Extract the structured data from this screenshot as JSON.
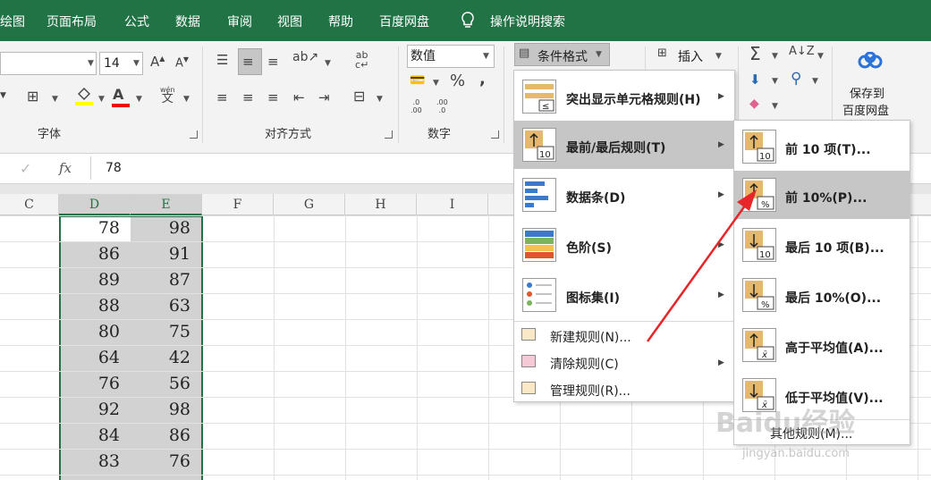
{
  "menubar": {
    "items": [
      "绘图",
      "页面布局",
      "公式",
      "数据",
      "审阅",
      "视图",
      "帮助",
      "百度网盘",
      "操作说明搜索"
    ]
  },
  "ribbon": {
    "font_size": "14",
    "font_group_label": "字体",
    "align_group_label": "对齐方式",
    "number_format": "数值",
    "number_group_label": "数字",
    "percent_symbol": "%",
    "comma_symbol": ",",
    "cond_format_label": "条件格式",
    "insert_label": "插入",
    "sum_symbol": "Σ",
    "baidu_save_line1": "保存到",
    "baidu_save_line2": "百度网盘",
    "ab_label": "ab",
    "c_label": "c",
    "wen_label": "wén",
    "wen_char": "文",
    "dec_add": ".0\n.00",
    "dec_rm": ".00\n.0"
  },
  "formula_bar": {
    "check": "✓",
    "fx": "fx",
    "value": "78"
  },
  "sheet": {
    "columns": [
      "C",
      "D",
      "E",
      "F",
      "G",
      "H",
      "I"
    ],
    "col_d": [
      "78",
      "86",
      "89",
      "88",
      "80",
      "64",
      "76",
      "92",
      "84",
      "83"
    ],
    "col_e": [
      "98",
      "91",
      "87",
      "63",
      "75",
      "42",
      "56",
      "98",
      "86",
      "76"
    ]
  },
  "cf_menu": {
    "items": [
      {
        "label": "突出显示单元格规则(H)"
      },
      {
        "label": "最前/最后规则(T)"
      },
      {
        "label": "数据条(D)"
      },
      {
        "label": "色阶(S)"
      },
      {
        "label": "图标集(I)"
      }
    ],
    "small_items": [
      {
        "label": "新建规则(N)..."
      },
      {
        "label": "清除规则(C)"
      },
      {
        "label": "管理规则(R)..."
      }
    ]
  },
  "sub_menu": {
    "items": [
      {
        "label": "前 10 项(T)..."
      },
      {
        "label": "前 10%(P)..."
      },
      {
        "label": "最后 10 项(B)..."
      },
      {
        "label": "最后 10%(O)..."
      },
      {
        "label": "高于平均值(A)..."
      },
      {
        "label": "低于平均值(V)..."
      }
    ],
    "other_rules": "其他规则(M)..."
  },
  "icon_text": {
    "ten": "10",
    "pct": "%",
    "xbar": "x̄"
  },
  "watermark": {
    "brand": "Baidu经验",
    "url": "jingyan.baidu.com"
  },
  "colors": {
    "excel_green": "#217346",
    "highlight": "#c6c6c6",
    "arrow_red": "#e8262a"
  }
}
